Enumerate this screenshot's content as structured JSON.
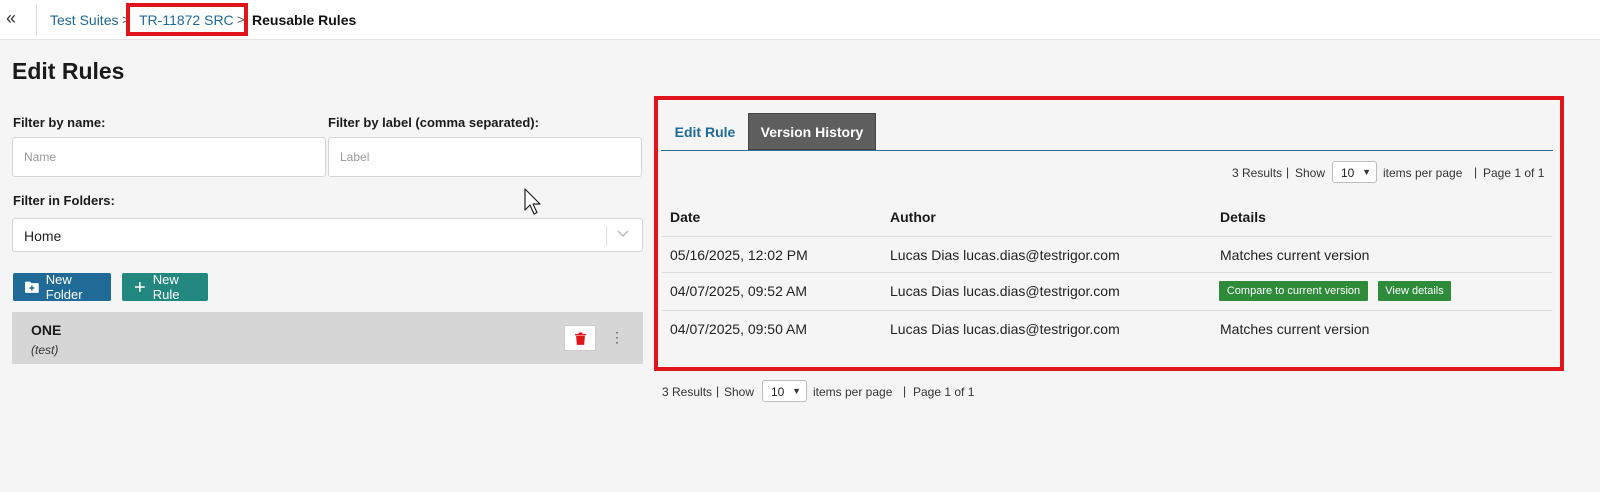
{
  "breadcrumb": {
    "items": [
      {
        "label": "Test Suites"
      },
      {
        "label": "TR-11872 SRC"
      },
      {
        "label": "Reusable Rules"
      }
    ],
    "separator": ">"
  },
  "page": {
    "title": "Edit Rules"
  },
  "filters": {
    "name_label": "Filter by name:",
    "name_placeholder": "Name",
    "label_label": "Filter by label (comma separated):",
    "label_placeholder": "Label",
    "folders_label": "Filter in Folders:",
    "folder_value": "Home"
  },
  "actions": {
    "new_folder": "New Folder",
    "new_rule": "New Rule"
  },
  "rules": [
    {
      "name": "ONE",
      "label": "(test)"
    }
  ],
  "tabs": [
    {
      "label": "Edit Rule"
    },
    {
      "label": "Version History",
      "active": true
    }
  ],
  "pager": {
    "results": "3 Results",
    "show": "Show",
    "per_page_value": "10",
    "items_per_page": "items per page",
    "page": "Page 1 of 1"
  },
  "history": {
    "columns": [
      "Date",
      "Author",
      "Details"
    ],
    "rows": [
      {
        "date": "05/16/2025, 12:02 PM",
        "author": "Lucas Dias lucas.dias@testrigor.com",
        "details": "Matches current version"
      },
      {
        "date": "04/07/2025, 09:52 AM",
        "author": "Lucas Dias lucas.dias@testrigor.com",
        "compare_button": "Compare to current version",
        "view_button": "View details"
      },
      {
        "date": "04/07/2025, 09:50 AM",
        "author": "Lucas Dias lucas.dias@testrigor.com",
        "details": "Matches current version"
      }
    ]
  },
  "colors": {
    "link": "#1e6a9a",
    "new_folder": "#1f6a96",
    "new_rule": "#22877e",
    "green_button": "#2e8b3a",
    "highlight": "#e0141b",
    "delete_icon": "#e0141b"
  }
}
